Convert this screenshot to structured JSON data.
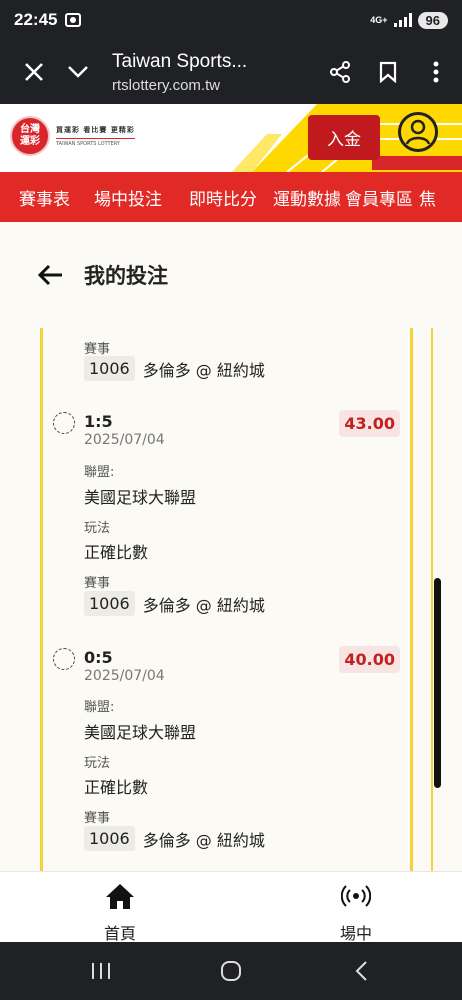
{
  "status_bar": {
    "time": "22:45",
    "network": "4G+",
    "battery": "96"
  },
  "browser": {
    "title": "Taiwan Sports...",
    "url": "rtslottery.com.tw"
  },
  "site": {
    "logo_zh_lines": [
      "台灣",
      "運彩"
    ],
    "logo_tagline": "買運彩  看比賽  更精彩",
    "logo_en": "TAIWAN SPORTS LOTTERY",
    "deposit_label": "入金"
  },
  "nav": {
    "items": [
      "賽事表",
      "場中投注",
      "即時比分",
      "運動數據",
      "會員專區",
      "焦"
    ]
  },
  "page": {
    "title": "我的投注"
  },
  "labels": {
    "league": "聯盟:",
    "play": "玩法",
    "event": "賽事"
  },
  "partial_bet": {
    "event_id": "1006",
    "event_name": "多倫多 @ 紐約城"
  },
  "bets": [
    {
      "score": "1:5",
      "date": "2025/07/04",
      "odds": "43.00",
      "league": "美國足球大聯盟",
      "play": "正確比數",
      "event_id": "1006",
      "event_name": "多倫多 @ 紐約城"
    },
    {
      "score": "0:5",
      "date": "2025/07/04",
      "odds": "40.00",
      "league": "美國足球大聯盟",
      "play": "正確比數",
      "event_id": "1006",
      "event_name": "多倫多 @ 紐約城"
    }
  ],
  "tabs": [
    {
      "label": "首頁",
      "icon": "home-icon"
    },
    {
      "label": "場中",
      "icon": "live-broadcast-icon"
    }
  ],
  "colors": {
    "brand_red": "#e12a26",
    "accent_yellow": "#ffd800",
    "odds_red": "#c0221f"
  }
}
